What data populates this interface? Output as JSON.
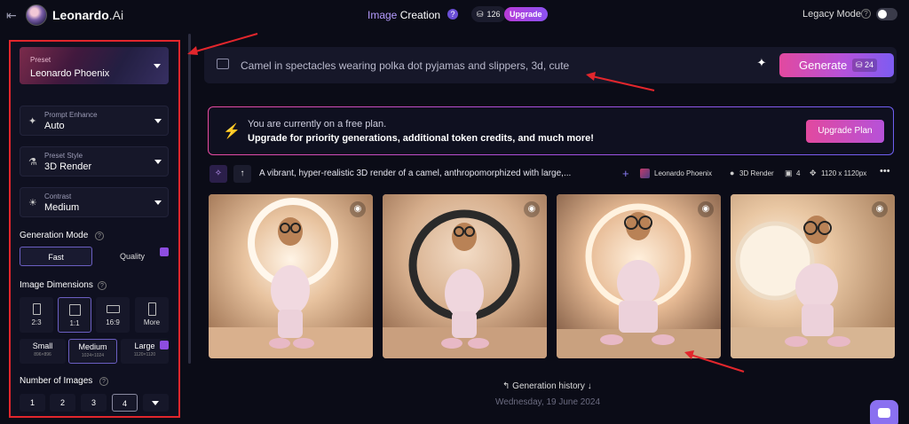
{
  "topbar": {
    "back_icon": "exit-arrow-icon",
    "brand": "Leonardo",
    "brand_suffix": ".Ai",
    "title_part1": "Image",
    "title_part2": "Creation",
    "help": "?",
    "tokens": "126",
    "upgrade": "Upgrade",
    "legacy_label": "Legacy Mode",
    "legacy_help": "?"
  },
  "sidebar": {
    "preset_label": "Preset",
    "preset_value": "Leonardo Phoenix",
    "prompt_enhance_label": "Prompt Enhance",
    "prompt_enhance_value": "Auto",
    "preset_style_label": "Preset Style",
    "preset_style_value": "3D Render",
    "contrast_label": "Contrast",
    "contrast_value": "Medium",
    "generation_mode_label": "Generation Mode",
    "mode_fast": "Fast",
    "mode_quality": "Quality",
    "image_dimensions_label": "Image Dimensions",
    "ratios": [
      "2:3",
      "1:1",
      "16:9",
      "More"
    ],
    "sizes": [
      {
        "name": "Small",
        "dims": "896×896"
      },
      {
        "name": "Medium",
        "dims": "1024×1024"
      },
      {
        "name": "Large",
        "dims": "1120×1120"
      }
    ],
    "number_of_images_label": "Number of Images",
    "counts": [
      "1",
      "2",
      "3",
      "4"
    ]
  },
  "prompt": {
    "text": "Camel in spectacles wearing polka dot pyjamas and slippers, 3d, cute",
    "generate": "Generate",
    "generate_tokens": "24"
  },
  "banner": {
    "line1": "You are currently on a free plan.",
    "line2": "Upgrade for priority generations, additional token credits, and much more!",
    "button": "Upgrade Plan"
  },
  "generation": {
    "prompt": "A vibrant, hyper-realistic 3D render of a camel, anthropomorphized with large,...",
    "preset": "Leonardo Phoenix",
    "style": "3D Render",
    "count": "4",
    "size": "1120 x 1120px"
  },
  "history": {
    "label": "Generation history",
    "date": "Wednesday, 19 June 2024"
  },
  "colors": {
    "accent": "#8a70f0",
    "highlight_border": "#e2262c",
    "generate_gradient_start": "#e2499f",
    "generate_gradient_end": "#7d5cf2"
  }
}
